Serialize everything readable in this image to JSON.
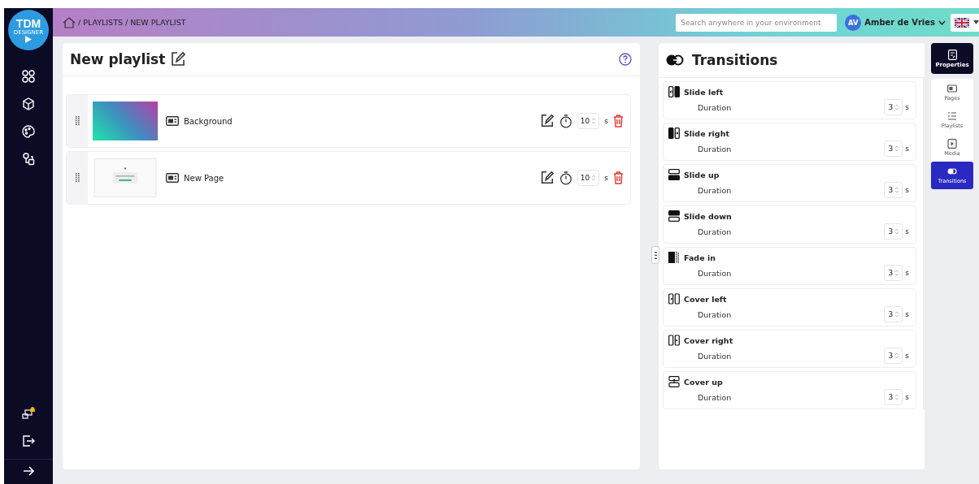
{
  "logo": {
    "title": "TDM",
    "subtitle": "DESIGNER"
  },
  "breadcrumb": "/ PLAYLISTS / NEW PLAYLIST",
  "search": {
    "placeholder": "Search anywhere in your environment"
  },
  "user": {
    "initials": "AV",
    "name": "Amber de Vries"
  },
  "playlist": {
    "title": "New playlist",
    "items": [
      {
        "kind": "gradient",
        "name": "Background",
        "duration": "10",
        "unit": "s"
      },
      {
        "kind": "page",
        "name": "New Page",
        "duration": "10",
        "unit": "s"
      }
    ]
  },
  "transitions": {
    "title": "Transitions",
    "items": [
      {
        "kind": "slide-left",
        "name": "Slide left",
        "label": "Duration",
        "value": "3",
        "unit": "s"
      },
      {
        "kind": "slide-right",
        "name": "Slide right",
        "label": "Duration",
        "value": "3",
        "unit": "s"
      },
      {
        "kind": "slide-up",
        "name": "Slide up",
        "label": "Duration",
        "value": "3",
        "unit": "s"
      },
      {
        "kind": "slide-down",
        "name": "Slide down",
        "label": "Duration",
        "value": "3",
        "unit": "s"
      },
      {
        "kind": "fade",
        "name": "Fade in",
        "label": "Duration",
        "value": "3",
        "unit": "s"
      },
      {
        "kind": "cover-left",
        "name": "Cover left",
        "label": "Duration",
        "value": "3",
        "unit": "s"
      },
      {
        "kind": "cover-right",
        "name": "Cover right",
        "label": "Duration",
        "value": "3",
        "unit": "s"
      },
      {
        "kind": "cover-up",
        "name": "Cover up",
        "label": "Duration",
        "value": "3",
        "unit": "s"
      }
    ]
  },
  "properties_button": {
    "label": "Properties",
    "selected": true
  },
  "side_tabs": [
    {
      "kind": "pages",
      "label": "Pages",
      "selected": false
    },
    {
      "kind": "playlists",
      "label": "Playlists",
      "selected": false
    },
    {
      "kind": "media",
      "label": "Media",
      "selected": false
    },
    {
      "kind": "transitions",
      "label": "Transitions",
      "selected": true
    }
  ]
}
